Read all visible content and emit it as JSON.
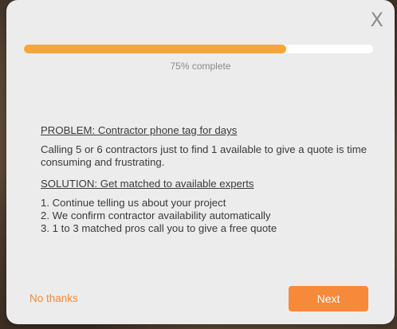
{
  "modal": {
    "close_label": "X",
    "progress": {
      "fraction": 0.75,
      "label": "75% complete",
      "fill_color": "#f7a53a",
      "track_color": "#ffffff"
    },
    "problem": {
      "heading": "PROBLEM: Contractor phone tag for days",
      "text": "Calling 5 or 6 contractors just to find 1 available to give a quote is time consuming and frustrating."
    },
    "solution": {
      "heading": "SOLUTION: Get matched to available experts",
      "steps": [
        "1. Continue telling us about your project",
        "2. We confirm contractor availability automatically",
        "3. 1 to 3 matched pros call you to give a free quote"
      ]
    },
    "footer": {
      "decline_label": "No thanks",
      "next_label": "Next",
      "accent_color": "#f7893a"
    }
  }
}
